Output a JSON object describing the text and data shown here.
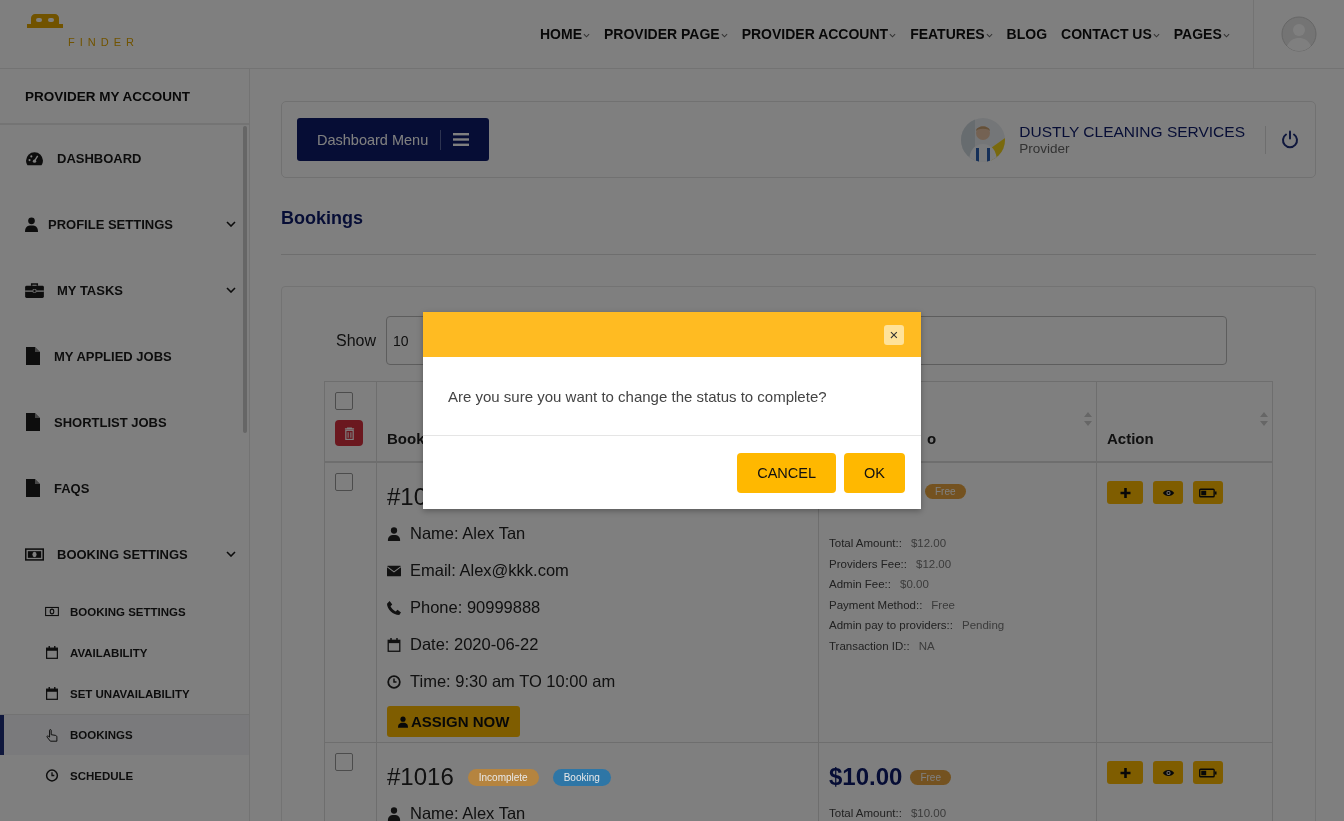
{
  "header": {
    "logo_text": "FINDER",
    "nav": [
      {
        "label": "HOME",
        "dropdown": true
      },
      {
        "label": "PROVIDER PAGE",
        "dropdown": true
      },
      {
        "label": "PROVIDER ACCOUNT",
        "dropdown": true
      },
      {
        "label": "FEATURES",
        "dropdown": true
      },
      {
        "label": "BLOG",
        "dropdown": false
      },
      {
        "label": "CONTACT US",
        "dropdown": true
      },
      {
        "label": "PAGES",
        "dropdown": true
      }
    ]
  },
  "sidebar": {
    "title": "PROVIDER MY ACCOUNT",
    "items": [
      {
        "label": "DASHBOARD",
        "submenu": false,
        "selected": false
      },
      {
        "label": "PROFILE SETTINGS",
        "submenu": true,
        "selected": false
      },
      {
        "label": "MY TASKS",
        "submenu": true,
        "selected": false
      },
      {
        "label": "MY APPLIED JOBS",
        "submenu": false,
        "selected": false
      },
      {
        "label": "SHORTLIST JOBS",
        "submenu": false,
        "selected": false
      },
      {
        "label": "FAQS",
        "submenu": false,
        "selected": false
      },
      {
        "label": "BOOKING SETTINGS",
        "submenu": true,
        "selected": false,
        "children": [
          {
            "label": "BOOKING SETTINGS",
            "selected": false
          },
          {
            "label": "AVAILABILITY",
            "selected": false
          },
          {
            "label": "SET UNAVAILABILITY",
            "selected": false
          },
          {
            "label": "BOOKINGS",
            "selected": true
          },
          {
            "label": "SCHEDULE",
            "selected": false
          }
        ]
      }
    ]
  },
  "dashboard_bar": {
    "menu_button": "Dashboard Menu",
    "profile_name": "DUSTLY CLEANING SERVICES",
    "profile_role": "Provider"
  },
  "page_title": "Bookings",
  "table": {
    "show_label": "Show",
    "show_value": "10",
    "select_all_checked": false,
    "columns": [
      "Book",
      "o",
      "Action"
    ],
    "rows": [
      {
        "checked": false,
        "id": "#10",
        "badges": [],
        "fields": [
          "Name: Alex Tan",
          "Email: Alex@kkk.com",
          "Phone: 90999888",
          "Date: 2020-06-22",
          "Time: 9:30 am TO 10:00 am"
        ],
        "assign_button": "ASSIGN NOW",
        "amount": "",
        "payment_badge": "Free",
        "details": [
          {
            "label": "Total Amount::",
            "value": "$12.00"
          },
          {
            "label": "Providers Fee::",
            "value": "$12.00"
          },
          {
            "label": "Admin Fee::",
            "value": "$0.00"
          },
          {
            "label": "Payment Method::",
            "value": "Free"
          },
          {
            "label": "Admin pay to providers::",
            "value": "Pending"
          },
          {
            "label": "Transaction ID::",
            "value": "NA"
          }
        ]
      },
      {
        "checked": false,
        "id": "#1016",
        "badges": [
          {
            "text": "Incomplete",
            "color": "#b5843f"
          },
          {
            "text": "Booking",
            "color": "#2e76a6"
          }
        ],
        "fields": [
          "Name: Alex Tan"
        ],
        "assign_button": "",
        "amount": "$10.00",
        "payment_badge": "Free",
        "details": [
          {
            "label": "Total Amount::",
            "value": "$10.00"
          }
        ]
      }
    ]
  },
  "modal": {
    "message": "Are you sure you want to change the status to complete?",
    "close": "×",
    "buttons": [
      "CANCEL",
      "OK"
    ]
  }
}
